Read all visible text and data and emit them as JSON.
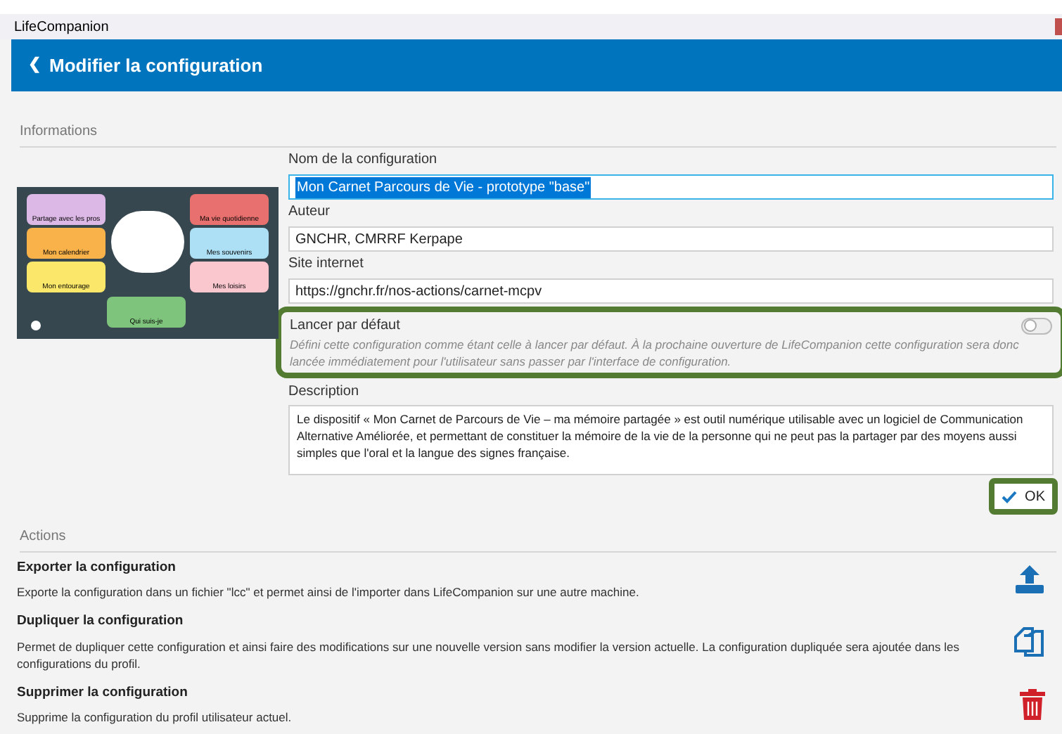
{
  "window": {
    "title": "LifeCompanion"
  },
  "header": {
    "back_icon": "❮",
    "title": "Modifier la configuration"
  },
  "informations": {
    "section_title": "Informations",
    "preview": {
      "left_tiles": [
        {
          "label": "Partage avec les pros",
          "color": "#dcb8e6"
        },
        {
          "label": "Mon calendrier",
          "color": "#f9b24a"
        },
        {
          "label": "Mon entourage",
          "color": "#fbe86a"
        }
      ],
      "right_tiles": [
        {
          "label": "Ma vie quotidienne",
          "color": "#e8706e"
        },
        {
          "label": "Mes souvenirs",
          "color": "#aee0f5"
        },
        {
          "label": "Mes loisirs",
          "color": "#fac7cf"
        }
      ],
      "bottom_tiles": [
        {
          "label": "Qui suis-je",
          "color": "#7fc47c"
        }
      ]
    },
    "name": {
      "label": "Nom de la configuration",
      "value": "Mon Carnet Parcours de Vie - prototype \"base\"",
      "focused": true
    },
    "author": {
      "label": "Auteur",
      "value": "GNCHR, CMRRF Kerpape"
    },
    "website": {
      "label": "Site internet",
      "value": "https://gnchr.fr/nos-actions/carnet-mcpv"
    },
    "launch_default": {
      "label": "Lancer par défaut",
      "on": false,
      "highlighted": true,
      "help": "Défini cette configuration comme étant celle à lancer par défaut. À la prochaine ouverture de LifeCompanion cette configuration sera donc lancée immédiatement pour l'utilisateur sans passer par l'interface de configuration."
    },
    "description": {
      "label": "Description",
      "value": "Le dispositif « Mon Carnet de Parcours de Vie – ma mémoire partagée » est outil numérique utilisable avec un logiciel de Communication Alternative Améliorée, et permettant de constituer la mémoire de la vie de la personne qui ne peut pas la partager par des moyens aussi simples que l'oral et la langue des signes française."
    },
    "ok_button": {
      "label": "OK",
      "highlighted": true
    }
  },
  "actions": {
    "section_title": "Actions",
    "items": [
      {
        "kind": "export",
        "title": "Exporter la configuration",
        "text": "Exporte la configuration dans un fichier \"lcc\" et permet ainsi de l'importer dans LifeCompanion sur une autre machine."
      },
      {
        "kind": "duplicate",
        "title": "Dupliquer la configuration",
        "text": "Permet de dupliquer cette configuration et ainsi faire des modifications sur une nouvelle version sans modifier la version actuelle. La configuration dupliquée sera ajoutée dans les configurations du profil."
      },
      {
        "kind": "delete",
        "title": "Supprimer la configuration",
        "text": "Supprime la configuration du profil utilisateur actuel."
      }
    ]
  }
}
